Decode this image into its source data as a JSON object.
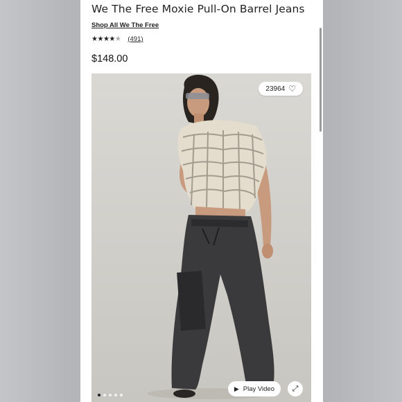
{
  "product": {
    "title": "We The Free Moxie Pull-On Barrel Jeans",
    "shop_link": "Shop All We The Free",
    "rating_stars": 4.5,
    "reviews": "(491)",
    "price": "$148.00"
  },
  "gallery": {
    "likes": "23964",
    "play_video_label": "Play Video",
    "slide_count": 5,
    "active_slide": 1
  },
  "icons": {
    "heart": "heart-icon",
    "play": "play-icon",
    "expand": "expand-icon"
  },
  "colors": {
    "page_bg": "#ffffff",
    "backdrop": "#b9b9bd",
    "text": "#222222"
  }
}
